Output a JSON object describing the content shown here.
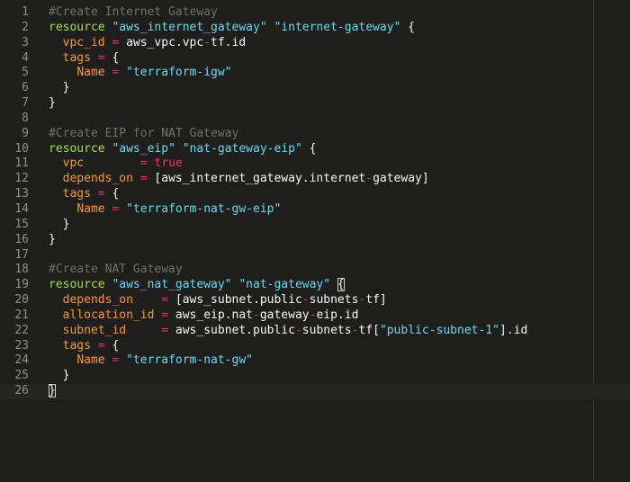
{
  "editor": {
    "lines": [
      {
        "num": "1",
        "tokens": [
          {
            "t": "c",
            "v": "#Create Internet Gateway"
          }
        ]
      },
      {
        "num": "2",
        "tokens": [
          {
            "t": "k",
            "v": "resource"
          },
          {
            "t": "p",
            "v": " "
          },
          {
            "t": "s",
            "v": "\"aws_internet_gateway\""
          },
          {
            "t": "p",
            "v": " "
          },
          {
            "t": "s",
            "v": "\"internet-gateway\""
          },
          {
            "t": "p",
            "v": " {"
          }
        ]
      },
      {
        "num": "3",
        "tokens": [
          {
            "t": "p",
            "v": "  "
          },
          {
            "t": "a",
            "v": "vpc_id"
          },
          {
            "t": "p",
            "v": " "
          },
          {
            "t": "o",
            "v": "="
          },
          {
            "t": "p",
            "v": " aws_vpc.vpc"
          },
          {
            "t": "o",
            "v": "-"
          },
          {
            "t": "p",
            "v": "tf.id"
          }
        ]
      },
      {
        "num": "4",
        "tokens": [
          {
            "t": "p",
            "v": "  "
          },
          {
            "t": "a",
            "v": "tags"
          },
          {
            "t": "p",
            "v": " "
          },
          {
            "t": "o",
            "v": "="
          },
          {
            "t": "p",
            "v": " {"
          }
        ]
      },
      {
        "num": "5",
        "tokens": [
          {
            "t": "p",
            "v": "    "
          },
          {
            "t": "a",
            "v": "Name"
          },
          {
            "t": "p",
            "v": " "
          },
          {
            "t": "o",
            "v": "="
          },
          {
            "t": "p",
            "v": " "
          },
          {
            "t": "s",
            "v": "\"terraform-igw\""
          }
        ]
      },
      {
        "num": "6",
        "tokens": [
          {
            "t": "p",
            "v": "  }"
          }
        ]
      },
      {
        "num": "7",
        "tokens": [
          {
            "t": "p",
            "v": "}"
          }
        ]
      },
      {
        "num": "8",
        "tokens": []
      },
      {
        "num": "9",
        "tokens": [
          {
            "t": "c",
            "v": "#Create EIP for NAT Gateway"
          }
        ]
      },
      {
        "num": "10",
        "tokens": [
          {
            "t": "k",
            "v": "resource"
          },
          {
            "t": "p",
            "v": " "
          },
          {
            "t": "s",
            "v": "\"aws_eip\""
          },
          {
            "t": "p",
            "v": " "
          },
          {
            "t": "s",
            "v": "\"nat-gateway-eip\""
          },
          {
            "t": "p",
            "v": " {"
          }
        ]
      },
      {
        "num": "11",
        "tokens": [
          {
            "t": "p",
            "v": "  "
          },
          {
            "t": "a",
            "v": "vpc"
          },
          {
            "t": "p",
            "v": "        "
          },
          {
            "t": "o",
            "v": "="
          },
          {
            "t": "p",
            "v": " "
          },
          {
            "t": "o",
            "v": "true"
          }
        ]
      },
      {
        "num": "12",
        "tokens": [
          {
            "t": "p",
            "v": "  "
          },
          {
            "t": "a",
            "v": "depends_on"
          },
          {
            "t": "p",
            "v": " "
          },
          {
            "t": "o",
            "v": "="
          },
          {
            "t": "p",
            "v": " [aws_internet_gateway.internet"
          },
          {
            "t": "o",
            "v": "-"
          },
          {
            "t": "p",
            "v": "gateway]"
          }
        ]
      },
      {
        "num": "13",
        "tokens": [
          {
            "t": "p",
            "v": "  "
          },
          {
            "t": "a",
            "v": "tags"
          },
          {
            "t": "p",
            "v": " "
          },
          {
            "t": "o",
            "v": "="
          },
          {
            "t": "p",
            "v": " {"
          }
        ]
      },
      {
        "num": "14",
        "tokens": [
          {
            "t": "p",
            "v": "    "
          },
          {
            "t": "a",
            "v": "Name"
          },
          {
            "t": "p",
            "v": " "
          },
          {
            "t": "o",
            "v": "="
          },
          {
            "t": "p",
            "v": " "
          },
          {
            "t": "s",
            "v": "\"terraform-nat-gw-eip\""
          }
        ]
      },
      {
        "num": "15",
        "tokens": [
          {
            "t": "p",
            "v": "  }"
          }
        ]
      },
      {
        "num": "16",
        "tokens": [
          {
            "t": "p",
            "v": "}"
          }
        ]
      },
      {
        "num": "17",
        "tokens": []
      },
      {
        "num": "18",
        "tokens": [
          {
            "t": "c",
            "v": "#Create NAT Gateway"
          }
        ]
      },
      {
        "num": "19",
        "tokens": [
          {
            "t": "k",
            "v": "resource"
          },
          {
            "t": "p",
            "v": " "
          },
          {
            "t": "s",
            "v": "\"aws_nat_gateway\""
          },
          {
            "t": "p",
            "v": " "
          },
          {
            "t": "s",
            "v": "\"nat-gateway\""
          },
          {
            "t": "p",
            "v": " "
          },
          {
            "t": "br",
            "v": "{"
          }
        ]
      },
      {
        "num": "20",
        "tokens": [
          {
            "t": "p",
            "v": "  "
          },
          {
            "t": "a",
            "v": "depends_on"
          },
          {
            "t": "p",
            "v": "    "
          },
          {
            "t": "o",
            "v": "="
          },
          {
            "t": "p",
            "v": " [aws_subnet.public"
          },
          {
            "t": "o",
            "v": "-"
          },
          {
            "t": "p",
            "v": "subnets"
          },
          {
            "t": "o",
            "v": "-"
          },
          {
            "t": "p",
            "v": "tf]"
          }
        ]
      },
      {
        "num": "21",
        "tokens": [
          {
            "t": "p",
            "v": "  "
          },
          {
            "t": "a",
            "v": "allocation_id"
          },
          {
            "t": "p",
            "v": " "
          },
          {
            "t": "o",
            "v": "="
          },
          {
            "t": "p",
            "v": " aws_eip.nat"
          },
          {
            "t": "o",
            "v": "-"
          },
          {
            "t": "p",
            "v": "gateway"
          },
          {
            "t": "o",
            "v": "-"
          },
          {
            "t": "p",
            "v": "eip.id"
          }
        ]
      },
      {
        "num": "22",
        "tokens": [
          {
            "t": "p",
            "v": "  "
          },
          {
            "t": "a",
            "v": "subnet_id"
          },
          {
            "t": "p",
            "v": "     "
          },
          {
            "t": "o",
            "v": "="
          },
          {
            "t": "p",
            "v": " aws_subnet.public"
          },
          {
            "t": "o",
            "v": "-"
          },
          {
            "t": "p",
            "v": "subnets"
          },
          {
            "t": "o",
            "v": "-"
          },
          {
            "t": "p",
            "v": "tf["
          },
          {
            "t": "s",
            "v": "\"public-subnet-1\""
          },
          {
            "t": "p",
            "v": "].id"
          }
        ]
      },
      {
        "num": "23",
        "tokens": [
          {
            "t": "p",
            "v": "  "
          },
          {
            "t": "a",
            "v": "tags"
          },
          {
            "t": "p",
            "v": " "
          },
          {
            "t": "o",
            "v": "="
          },
          {
            "t": "p",
            "v": " {"
          }
        ]
      },
      {
        "num": "24",
        "tokens": [
          {
            "t": "p",
            "v": "    "
          },
          {
            "t": "a",
            "v": "Name"
          },
          {
            "t": "p",
            "v": " "
          },
          {
            "t": "o",
            "v": "="
          },
          {
            "t": "p",
            "v": " "
          },
          {
            "t": "s",
            "v": "\"terraform-nat-gw\""
          }
        ]
      },
      {
        "num": "25",
        "tokens": [
          {
            "t": "p",
            "v": "  }"
          }
        ]
      },
      {
        "num": "26",
        "tokens": [
          {
            "t": "br",
            "v": "}"
          }
        ],
        "current": true
      }
    ]
  },
  "colors": {
    "background": "#1e1f1c",
    "line_number": "#8f908a",
    "comment": "#75715e",
    "keyword": "#a6e22e",
    "string": "#66d9ef",
    "attribute": "#fd971f",
    "operator": "#f92672",
    "text": "#f8f8f2"
  }
}
